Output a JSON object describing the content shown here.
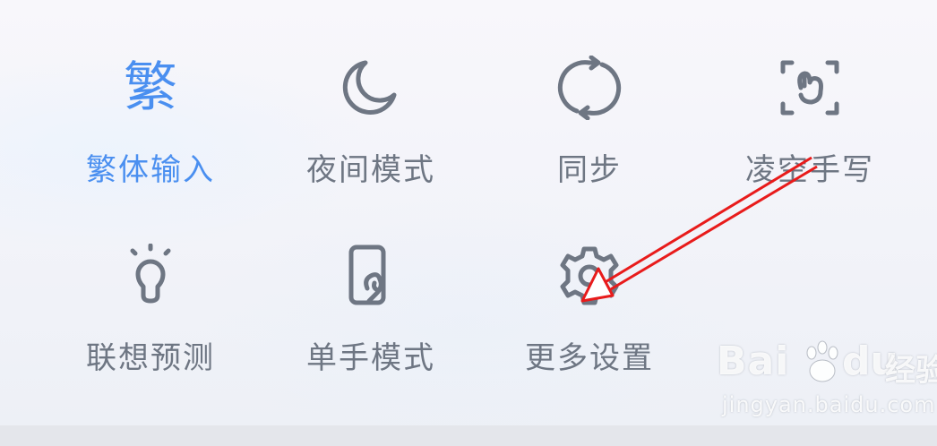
{
  "grid": {
    "items": [
      {
        "label": "繁体输入",
        "icon": "traditional-chinese-icon",
        "glyph": "繁",
        "active": true
      },
      {
        "label": "夜间模式",
        "icon": "moon-icon",
        "active": false
      },
      {
        "label": "同步",
        "icon": "sync-icon",
        "active": false
      },
      {
        "label": "凌空手写",
        "icon": "air-handwriting-icon",
        "active": false
      },
      {
        "label": "联想预测",
        "icon": "lightbulb-icon",
        "active": false
      },
      {
        "label": "单手模式",
        "icon": "one-hand-icon",
        "active": false
      },
      {
        "label": "更多设置",
        "icon": "gear-icon",
        "active": false
      }
    ]
  },
  "annotation": {
    "arrow_color": "#e81b1b",
    "points_to": "更多设置"
  },
  "watermark": {
    "brand_a": "Bai",
    "brand_b": "du",
    "brand_cn": "经验",
    "url": "jingyan.baidu.com"
  },
  "colors": {
    "active": "#4a8ff0",
    "inactive": "#6e7683"
  }
}
